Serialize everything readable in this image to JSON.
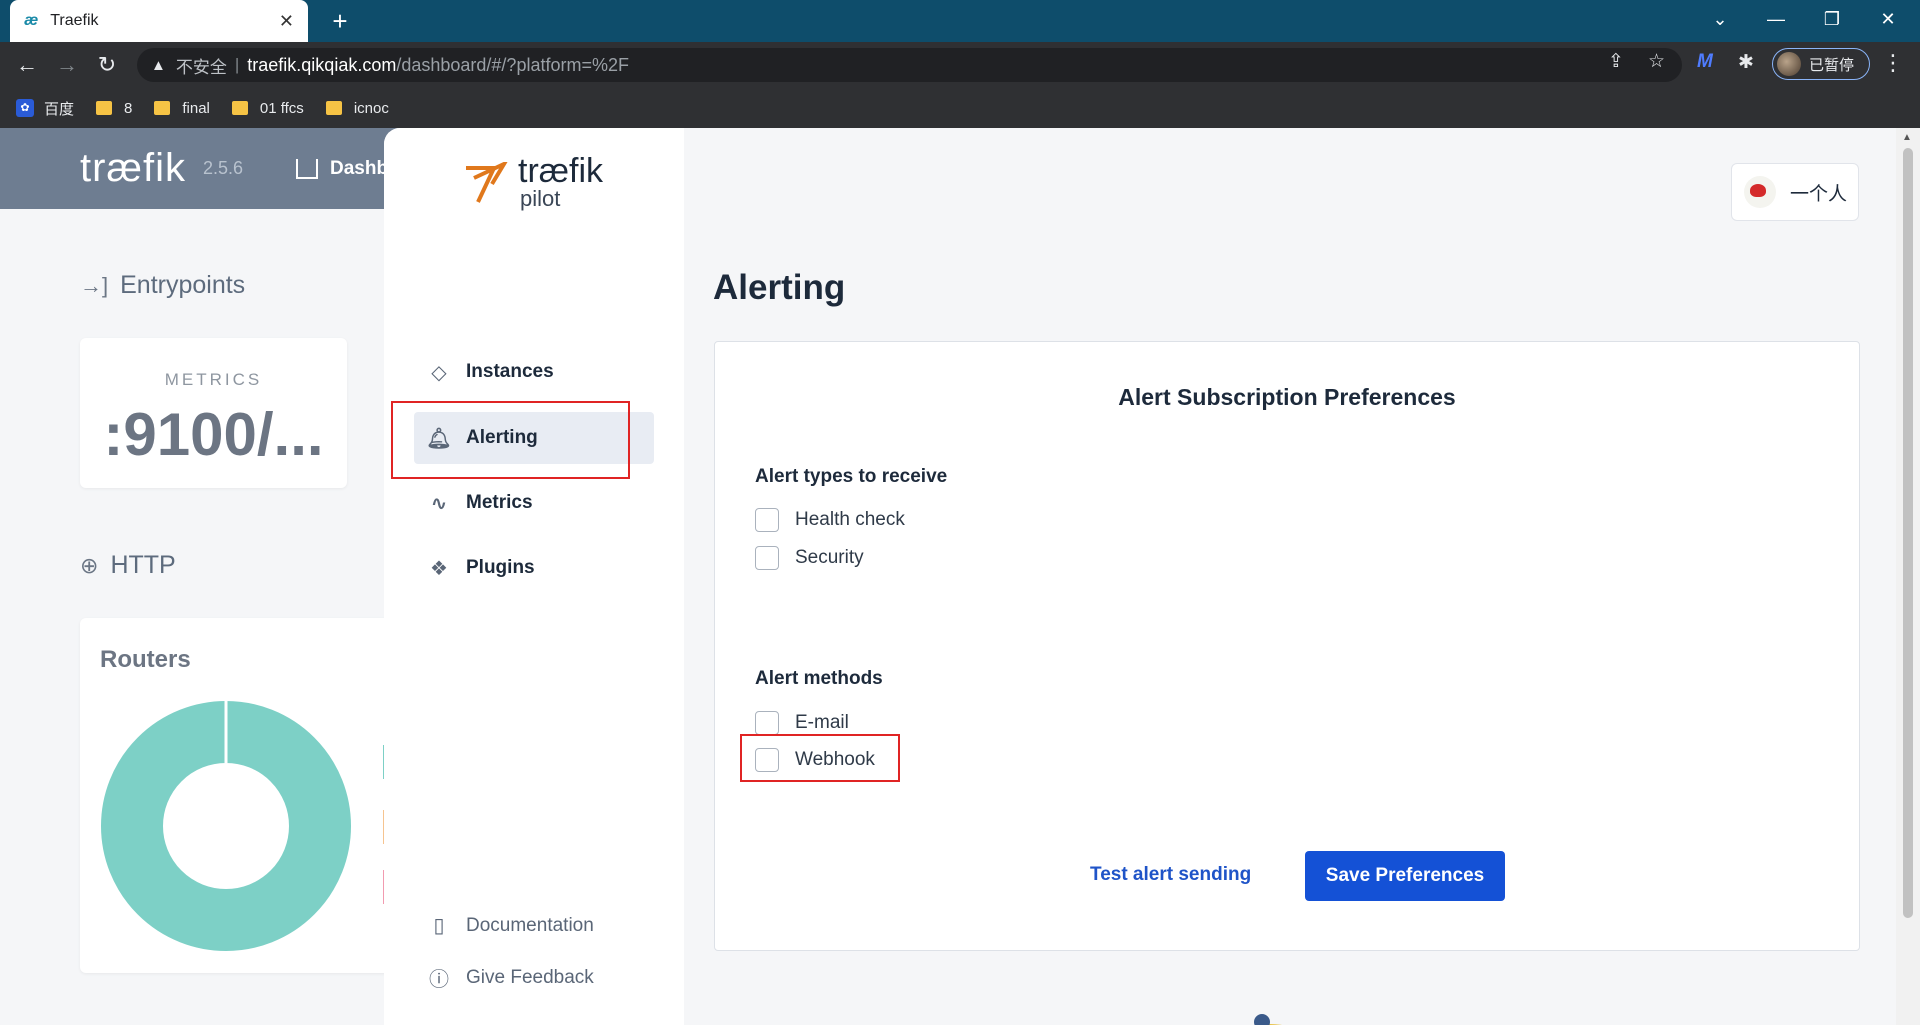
{
  "browser": {
    "tab_title": "Traefik",
    "tab_favicon": "æ",
    "new_tab": "+",
    "url_insecure_label": "不安全",
    "url_host": "traefik.qikqiak.com",
    "url_path": "/dashboard/#/?platform=%2F",
    "profile_label": "已暂停",
    "bookmarks": [
      {
        "label": "百度",
        "icon": "baidu-icon"
      },
      {
        "label": "8",
        "icon": "folder-icon"
      },
      {
        "label": "final",
        "icon": "folder-icon"
      },
      {
        "label": "01 ffcs",
        "icon": "folder-icon"
      },
      {
        "label": "icnoc",
        "icon": "folder-icon"
      }
    ]
  },
  "dashboard": {
    "logo": "træfik",
    "version": "2.5.6",
    "nav_home": "Dashb",
    "entrypoints_title": "Entrypoints",
    "metrics_label": "METRICS",
    "metrics_value": ":9100/...",
    "http_title": "HTTP",
    "routers_title": "Routers",
    "routers_chart_color": "#7dd0c6"
  },
  "pilot": {
    "logo_top": "træfik",
    "logo_bottom": "pilot",
    "nav": [
      {
        "label": "Instances",
        "icon": "instances-icon"
      },
      {
        "label": "Alerting",
        "icon": "bell-icon",
        "active": true
      },
      {
        "label": "Metrics",
        "icon": "pulse-icon"
      },
      {
        "label": "Plugins",
        "icon": "plugins-icon"
      }
    ],
    "footer": [
      {
        "label": "Documentation",
        "icon": "book-icon"
      },
      {
        "label": "Give Feedback",
        "icon": "exclamation-icon"
      }
    ],
    "user_name": "一个人",
    "page_title": "Alerting",
    "card_title": "Alert Subscription Preferences",
    "alert_types_label": "Alert types to receive",
    "alert_types": [
      {
        "label": "Health check",
        "checked": false
      },
      {
        "label": "Security",
        "checked": false
      }
    ],
    "alert_methods_label": "Alert methods",
    "alert_methods": [
      {
        "label": "E-mail",
        "checked": false
      },
      {
        "label": "Webhook",
        "checked": false
      }
    ],
    "test_button": "Test alert sending",
    "save_button": "Save Preferences",
    "accent_color": "#1451d6",
    "highlight_color": "#e02424"
  }
}
